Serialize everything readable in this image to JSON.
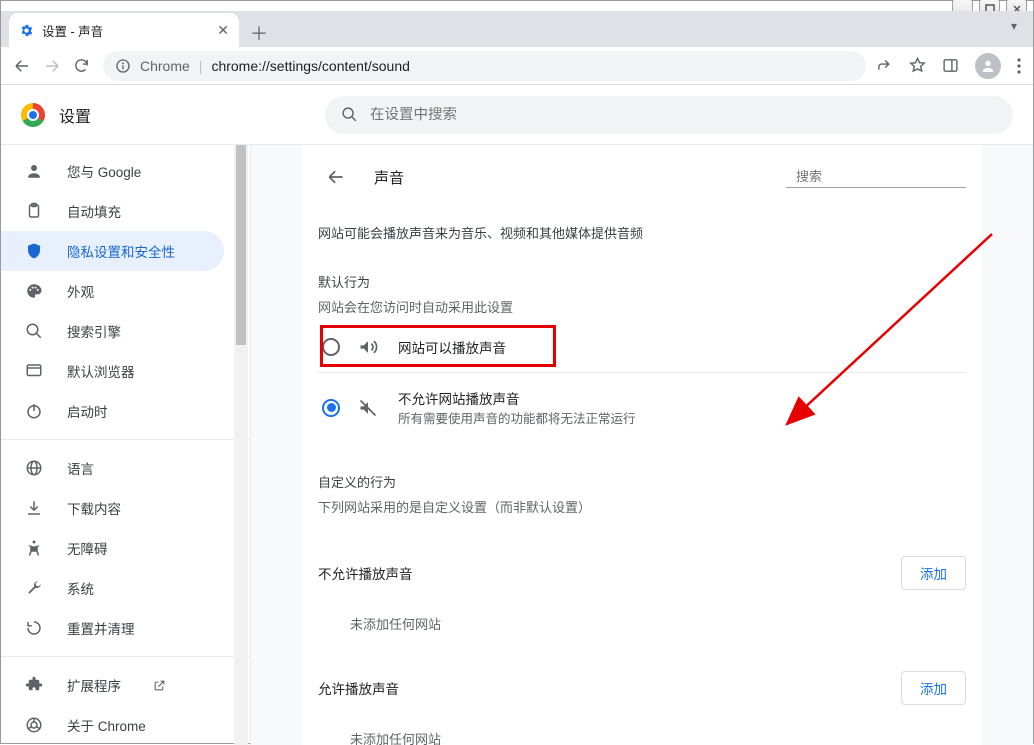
{
  "window": {
    "tab_title": "设置 - 声音"
  },
  "toolbar": {
    "chrome_label": "Chrome",
    "url": "chrome://settings/content/sound"
  },
  "header": {
    "title": "设置",
    "search_placeholder": "在设置中搜索"
  },
  "sidebar": {
    "items": [
      {
        "icon": "person",
        "label": "您与 Google"
      },
      {
        "icon": "clipboard",
        "label": "自动填充"
      },
      {
        "icon": "shield",
        "label": "隐私设置和安全性"
      },
      {
        "icon": "palette",
        "label": "外观"
      },
      {
        "icon": "search",
        "label": "搜索引擎"
      },
      {
        "icon": "browser",
        "label": "默认浏览器"
      },
      {
        "icon": "power",
        "label": "启动时"
      }
    ],
    "group2": [
      {
        "icon": "globe",
        "label": "语言"
      },
      {
        "icon": "download",
        "label": "下载内容"
      },
      {
        "icon": "a11y",
        "label": "无障碍"
      },
      {
        "icon": "wrench",
        "label": "系统"
      },
      {
        "icon": "reset",
        "label": "重置并清理"
      }
    ],
    "group3": [
      {
        "icon": "ext",
        "label": "扩展程序",
        "external": true
      },
      {
        "icon": "chrome",
        "label": "关于 Chrome"
      }
    ]
  },
  "content": {
    "page_title": "声音",
    "search_placeholder": "搜索",
    "description": "网站可能会播放声音来为音乐、视频和其他媒体提供音频",
    "default_section_title": "默认行为",
    "default_section_sub": "网站会在您访问时自动采用此设置",
    "options": [
      {
        "label": "网站可以播放声音",
        "sub": "",
        "icon": "volume",
        "checked": false
      },
      {
        "label": "不允许网站播放声音",
        "sub": "所有需要使用声音的功能都将无法正常运行",
        "icon": "volume-off",
        "checked": true
      }
    ],
    "custom_section_title": "自定义的行为",
    "custom_section_sub": "下列网站采用的是自定义设置（而非默认设置）",
    "block_list_title": "不允许播放声音",
    "allow_list_title": "允许播放声音",
    "add_label": "添加",
    "empty_label": "未添加任何网站"
  }
}
